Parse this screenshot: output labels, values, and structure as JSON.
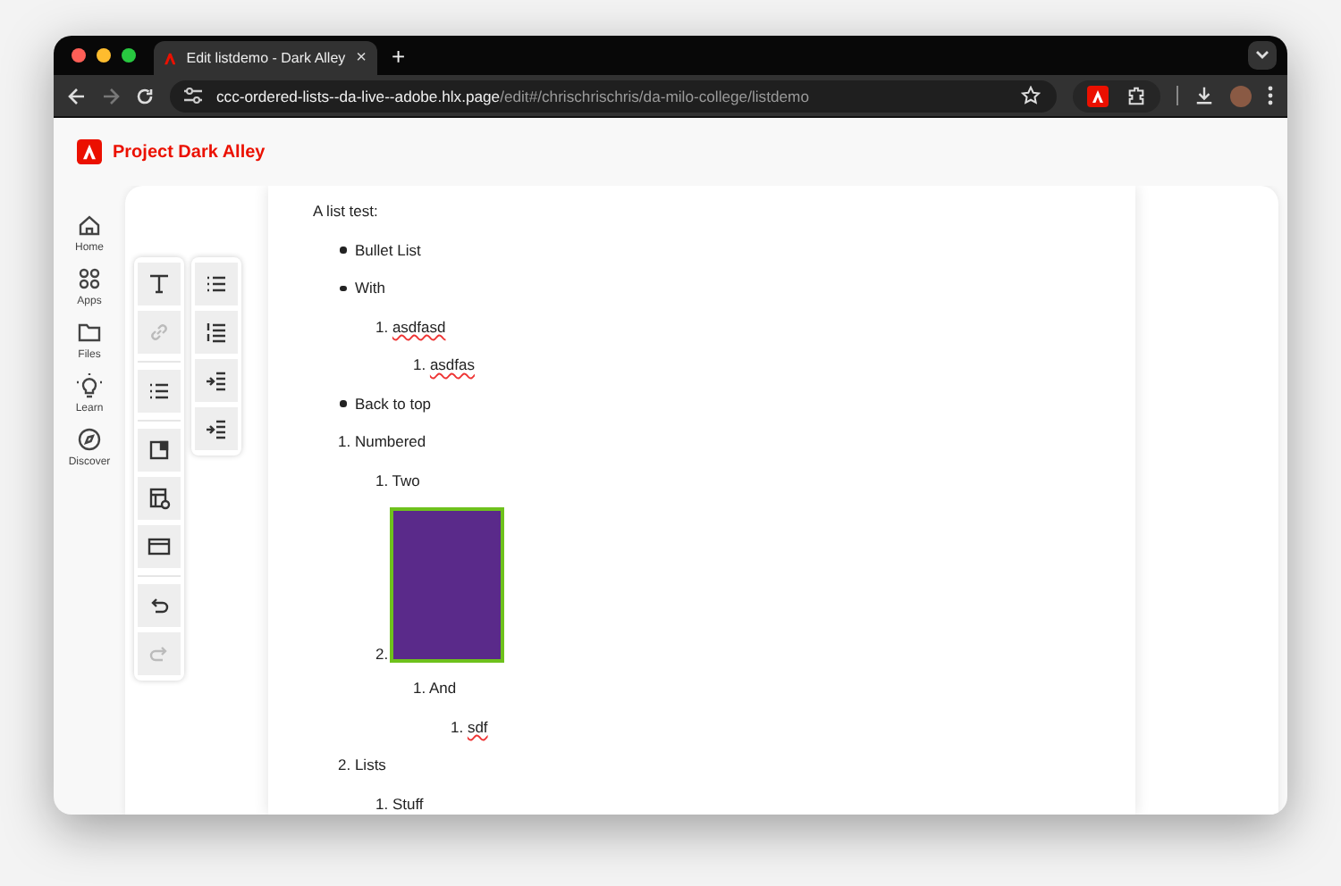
{
  "browser": {
    "tab": {
      "title": "Edit listdemo - Dark Alley",
      "close": "×"
    },
    "new_tab": "+",
    "url": {
      "host": "ccc-ordered-lists--da-live--adobe.hlx.page",
      "path": "/edit#/chrischrischris/da-milo-college/listdemo"
    }
  },
  "app": {
    "title": "Project Dark Alley"
  },
  "nav": [
    {
      "label": "Home",
      "kind": "home"
    },
    {
      "label": "Apps",
      "kind": "apps"
    },
    {
      "label": "Files",
      "kind": "files"
    },
    {
      "label": "Learn",
      "kind": "learn"
    },
    {
      "label": "Discover",
      "kind": "discover"
    }
  ],
  "toolbar": [
    [
      [
        {
          "kind": "text",
          "disabled": false
        },
        {
          "kind": "link",
          "disabled": true
        }
      ],
      [
        {
          "kind": "list",
          "disabled": false
        }
      ],
      [
        {
          "kind": "block",
          "disabled": false
        },
        {
          "kind": "table",
          "disabled": false
        },
        {
          "kind": "section",
          "disabled": false
        }
      ],
      [
        {
          "kind": "undo",
          "disabled": false
        },
        {
          "kind": "redo",
          "disabled": true
        }
      ]
    ],
    [
      [
        {
          "kind": "bullet-list",
          "disabled": false
        },
        {
          "kind": "numbered-list",
          "disabled": false
        },
        {
          "kind": "indent",
          "disabled": false
        },
        {
          "kind": "outdent",
          "disabled": false
        }
      ]
    ]
  ],
  "document": {
    "paragraph": "A list test:",
    "lists": [
      {
        "kind": "bullet",
        "items": [
          {
            "text": "Bullet List",
            "misspelled": false
          },
          {
            "text": "With",
            "misspelled": false,
            "children": {
              "kind": "numbered",
              "items": [
                {
                  "number": "1.",
                  "text": "asdfasd",
                  "misspelled": true,
                  "children": {
                    "kind": "numbered",
                    "items": [
                      {
                        "number": "1.",
                        "text": "asdfas",
                        "misspelled": true
                      }
                    ]
                  }
                }
              ]
            }
          },
          {
            "text": "Back to top",
            "misspelled": false
          }
        ]
      },
      {
        "kind": "numbered",
        "items": [
          {
            "number": "1.",
            "text": "Numbered",
            "misspelled": false,
            "children": {
              "kind": "numbered",
              "items": [
                {
                  "number": "1.",
                  "text": "Two",
                  "misspelled": false
                },
                {
                  "number": "2.",
                  "kind": "image",
                  "children": {
                    "kind": "numbered",
                    "items": [
                      {
                        "number": "1.",
                        "text": "And",
                        "misspelled": false,
                        "children": {
                          "kind": "numbered",
                          "items": [
                            {
                              "number": "1.",
                              "text": "sdf",
                              "misspelled": true
                            }
                          ]
                        }
                      }
                    ]
                  }
                }
              ]
            }
          },
          {
            "number": "2.",
            "text": "Lists",
            "misspelled": false,
            "children": {
              "kind": "numbered",
              "items": [
                {
                  "number": "1.",
                  "text": "Stuff",
                  "misspelled": false
                }
              ]
            }
          }
        ]
      }
    ]
  }
}
